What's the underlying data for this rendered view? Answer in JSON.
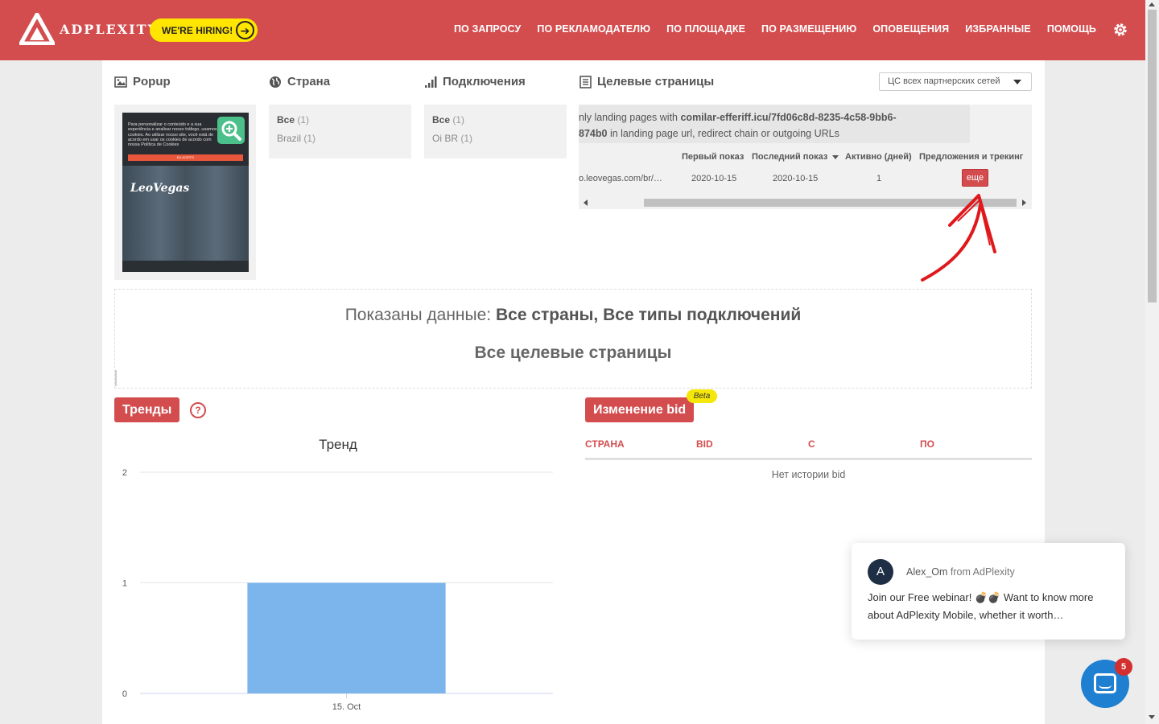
{
  "header": {
    "logo_text": "ADPLEXITY",
    "hiring_label": "WE'RE HIRING!",
    "nav": [
      "ПО ЗАПРОСУ",
      "ПО РЕКЛАМОДАТЕЛЮ",
      "ПО ПЛОЩАДКЕ",
      "ПО РАЗМЕЩЕНИЮ",
      "ОПОВЕЩЕНИЯ",
      "ИЗБРАННЫЕ",
      "ПОМОЩЬ"
    ],
    "accent_color": "#d34d4f"
  },
  "sections": {
    "popup_title": "Popup",
    "country_title": "Страна",
    "connections_title": "Подключения",
    "landings_title": "Целевые страницы"
  },
  "popup": {
    "text": "Para personalizar o conteúdo e a sua experiência e analisar nosso tráfego, usamos cookies. Ao utilizar nosso site, você está de acordo em usar os cookies de acordo com nossa Política de Cookies",
    "button": "EU ACEITO",
    "brand": "LeoVegas"
  },
  "country_filter": {
    "all_label": "Все",
    "all_count": "(1)",
    "item_label": "Brazil",
    "item_count": "(1)"
  },
  "connection_filter": {
    "all_label": "Все",
    "all_count": "(1)",
    "item_label": "Oi BR",
    "item_count": "(1)"
  },
  "landings": {
    "select_label": "ЦС всех партнерских сетей",
    "note_prefix": "nly landing pages with",
    "note_url_1": "comilar-efferiff.icu/7fd06c8d-8235-4c58-9bb6-",
    "note_url_2": "874b0",
    "note_suffix": "in landing page url, redirect chain or outgoing URLs",
    "columns": [
      "Первый показ",
      "Последний показ",
      "Активно (дней)",
      "Предложения и трекинг"
    ],
    "row": {
      "url": "o.leovegas.com/br/…",
      "first": "2020-10-15",
      "last": "2020-10-15",
      "active": "1",
      "more": "еще"
    }
  },
  "summary": {
    "prefix": "Показаны данные:",
    "selection": "Все страны, Все типы подключений",
    "landings": "Все целевые страницы"
  },
  "trends": {
    "label": "Тренды",
    "help": "?"
  },
  "bid": {
    "label": "Изменение bid",
    "beta": "Beta",
    "columns": [
      "СТРАНА",
      "BID",
      "С",
      "ПО"
    ],
    "empty": "Нет истории bid"
  },
  "chart_data": {
    "type": "bar",
    "title": "Тренд",
    "categories": [
      "15. Oct"
    ],
    "values": [
      1
    ],
    "ylim": [
      0,
      2
    ],
    "yticks": [
      0,
      1,
      2
    ],
    "xlabel": "",
    "ylabel": "",
    "grid": true,
    "bar_color": "#7cb5ec"
  },
  "chat": {
    "avatar": "A",
    "from_name": "Alex_Om",
    "from_org": "from AdPlexity",
    "message": "Join our Free webinar! 💣💣 Want to know more about AdPlexity Mobile, whether it worth…",
    "unread": "5"
  }
}
